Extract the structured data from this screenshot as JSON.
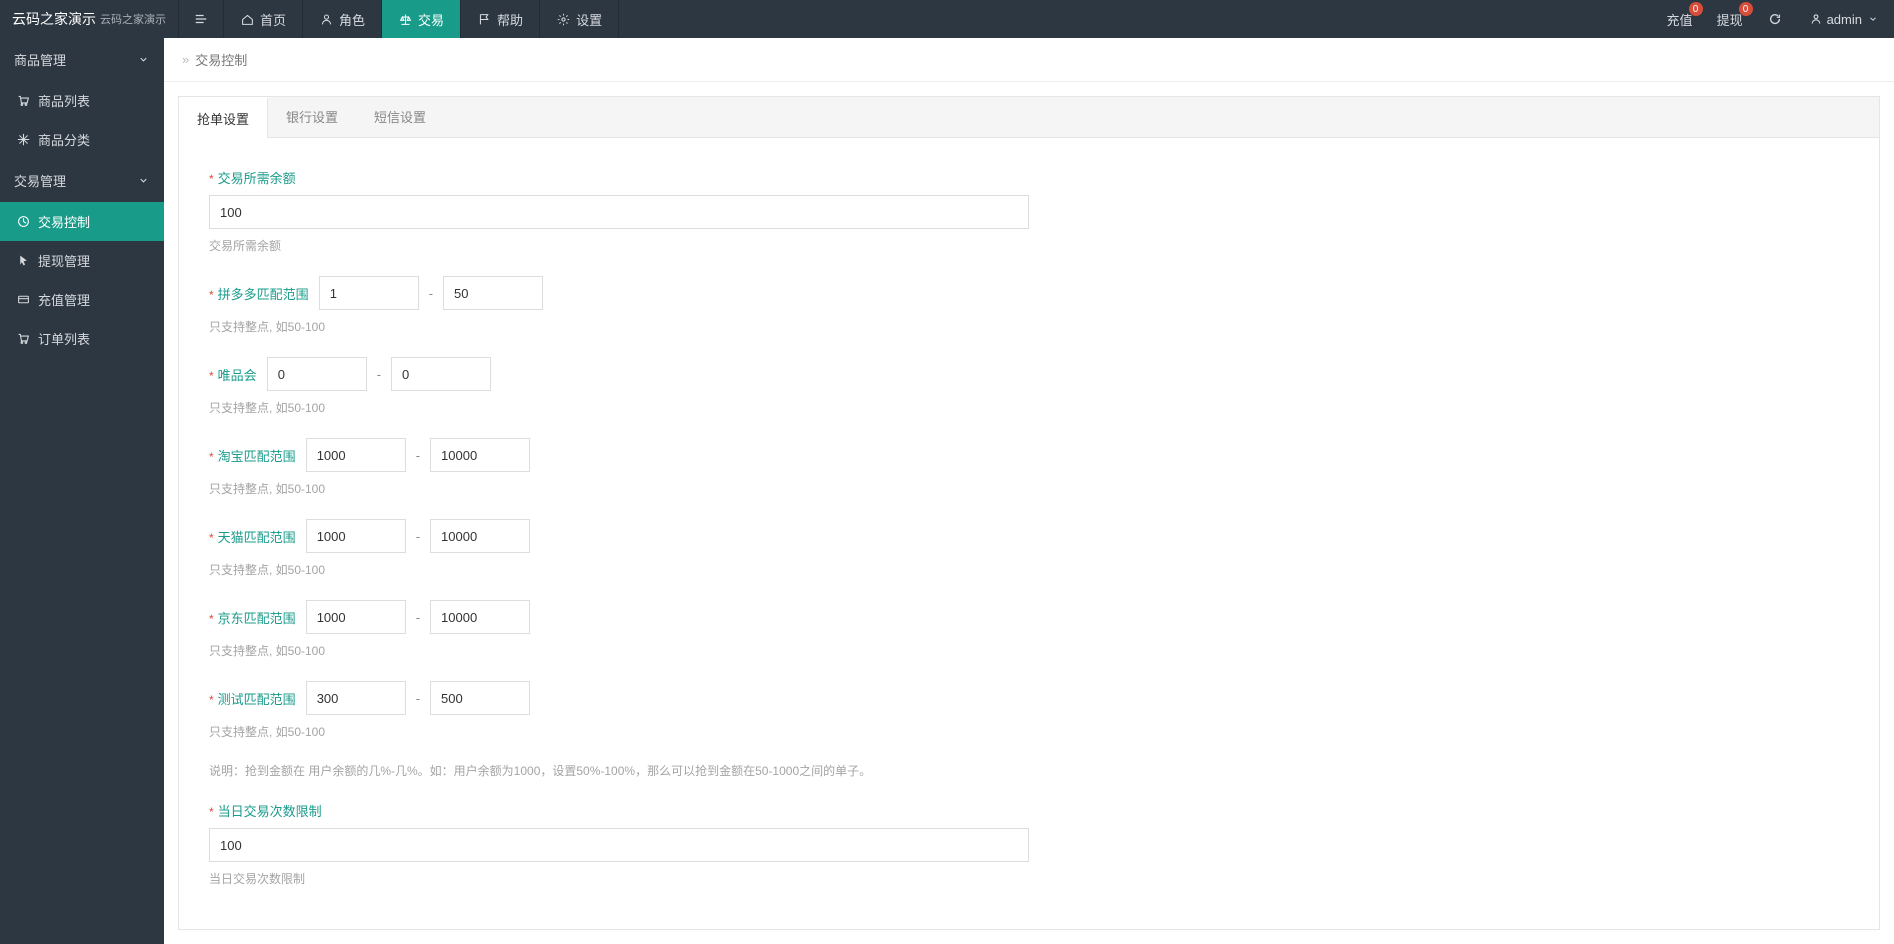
{
  "brand": {
    "title": "云码之家演示",
    "subtitle": "云码之家演示"
  },
  "topnav": {
    "items": [
      {
        "label": "首页",
        "icon": "home"
      },
      {
        "label": "角色",
        "icon": "user"
      },
      {
        "label": "交易",
        "icon": "scale",
        "active": true
      },
      {
        "label": "帮助",
        "icon": "flag"
      },
      {
        "label": "设置",
        "icon": "gear"
      }
    ]
  },
  "topright": {
    "recharge": "充值",
    "recharge_badge": "0",
    "withdraw": "提现",
    "withdraw_badge": "0",
    "admin_label": "admin"
  },
  "sidebar": {
    "groups": [
      {
        "title": "商品管理",
        "items": [
          {
            "label": "商品列表",
            "icon": "cart"
          },
          {
            "label": "商品分类",
            "icon": "snow"
          }
        ]
      },
      {
        "title": "交易管理",
        "items": [
          {
            "label": "交易控制",
            "icon": "clock",
            "active": true
          },
          {
            "label": "提现管理",
            "icon": "pointer"
          },
          {
            "label": "充值管理",
            "icon": "card"
          },
          {
            "label": "订单列表",
            "icon": "cart2"
          }
        ]
      }
    ]
  },
  "breadcrumb": {
    "title": "交易控制"
  },
  "tabs": [
    {
      "label": "抢单设置",
      "active": true
    },
    {
      "label": "银行设置"
    },
    {
      "label": "短信设置"
    }
  ],
  "form": {
    "balance": {
      "label": "交易所需余额",
      "value": "100",
      "help": "交易所需余额"
    },
    "ranges": [
      {
        "key": "pdd",
        "label": "拼多多匹配范围",
        "from": "1",
        "to": "50",
        "help": "只支持整点, 如50-100"
      },
      {
        "key": "vip",
        "label": "唯品会",
        "from": "0",
        "to": "0",
        "help": "只支持整点, 如50-100"
      },
      {
        "key": "taobao",
        "label": "淘宝匹配范围",
        "from": "1000",
        "to": "10000",
        "help": "只支持整点, 如50-100"
      },
      {
        "key": "tmall",
        "label": "天猫匹配范围",
        "from": "1000",
        "to": "10000",
        "help": "只支持整点, 如50-100"
      },
      {
        "key": "jd",
        "label": "京东匹配范围",
        "from": "1000",
        "to": "10000",
        "help": "只支持整点, 如50-100"
      },
      {
        "key": "test",
        "label": "测试匹配范围",
        "from": "300",
        "to": "500",
        "help": "只支持整点, 如50-100"
      }
    ],
    "note": "说明：抢到金额在 用户余额的几%-几%。如：用户余额为1000，设置50%-100%，那么可以抢到金额在50-1000之间的单子。",
    "dailyLimit": {
      "label": "当日交易次数限制",
      "value": "100",
      "help": "当日交易次数限制"
    }
  }
}
